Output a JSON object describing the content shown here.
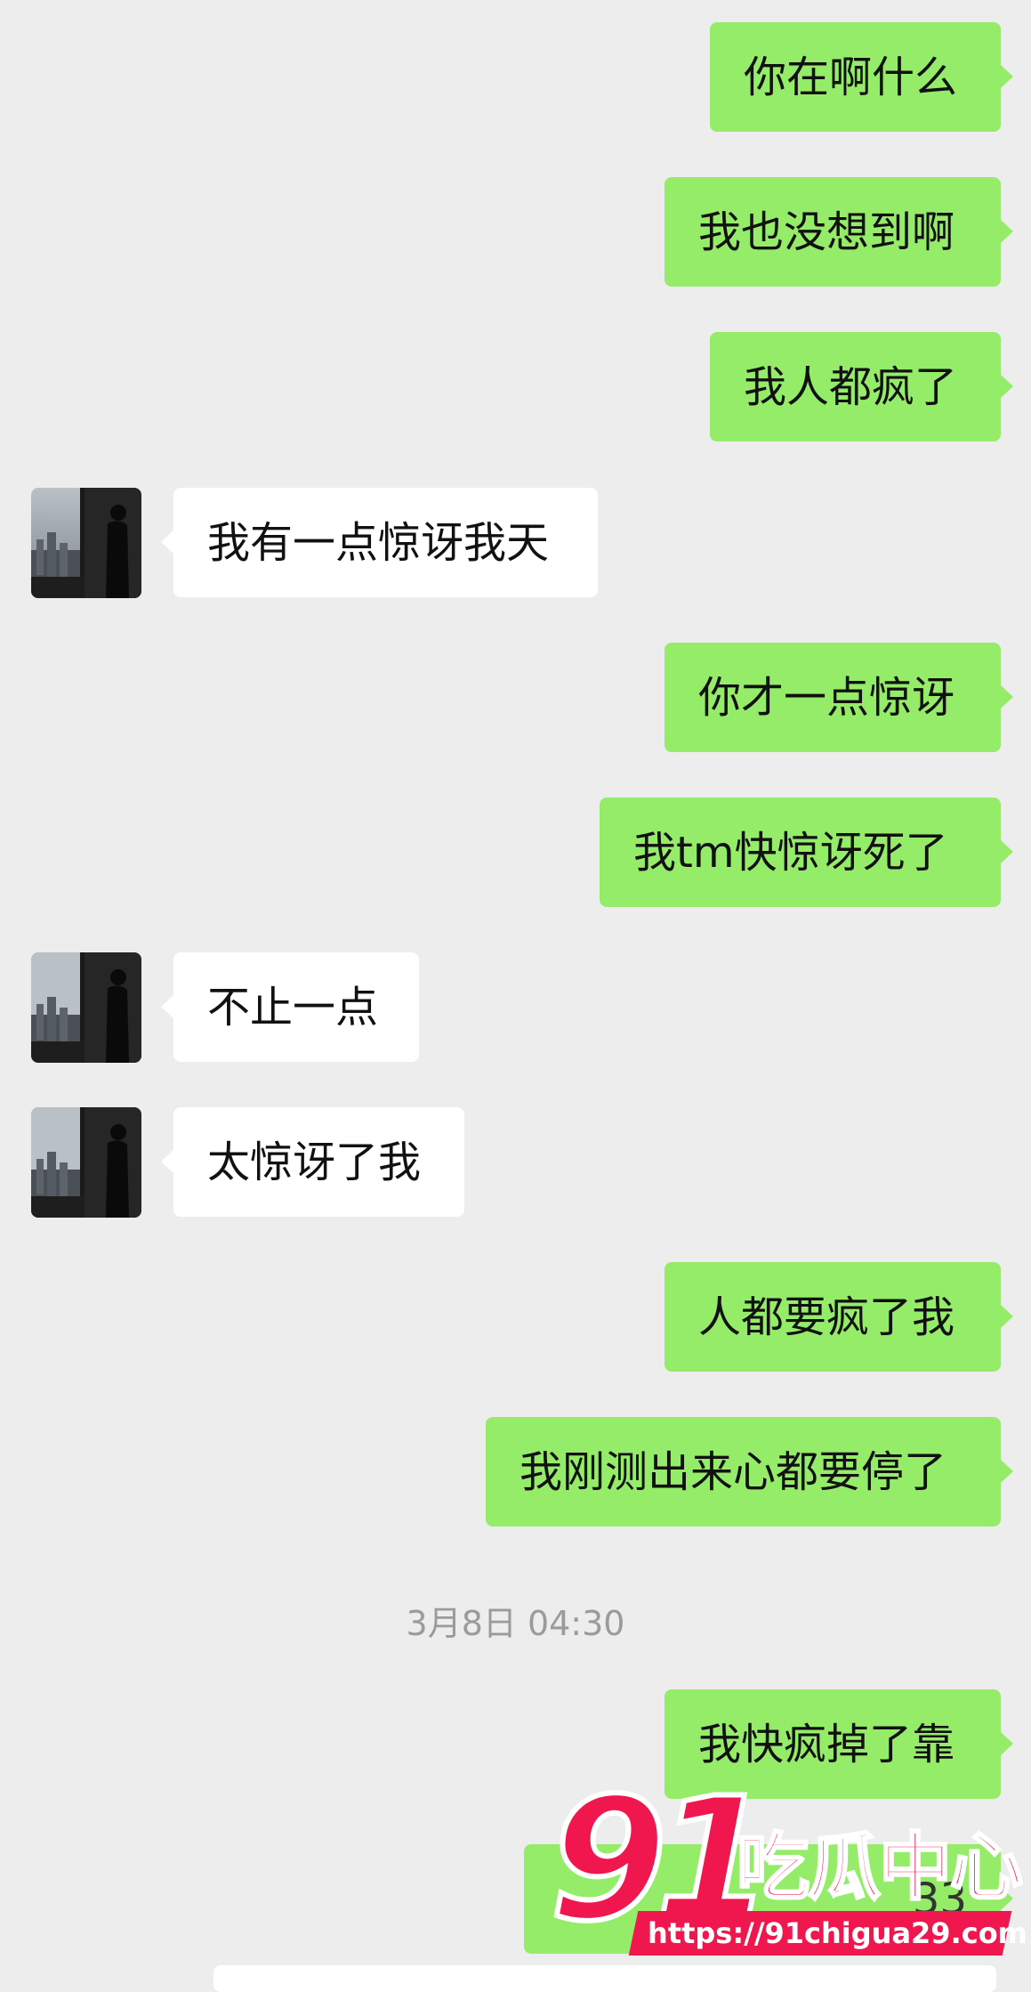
{
  "messages": [
    {
      "side": "out",
      "text": "你在啊什么"
    },
    {
      "side": "out",
      "text": "我也没想到啊"
    },
    {
      "side": "out",
      "text": "我人都疯了"
    },
    {
      "side": "in",
      "text": "我有一点惊讶我天"
    },
    {
      "side": "out",
      "text": "你才一点惊讶"
    },
    {
      "side": "out",
      "text": "我tm快惊讶死了"
    },
    {
      "side": "in",
      "text": "不止一点"
    },
    {
      "side": "in",
      "text": "太惊讶了我"
    },
    {
      "side": "out",
      "text": "人都要疯了我"
    },
    {
      "side": "out",
      "text": "我刚测出来心都要停了"
    },
    {
      "side": "out",
      "text": "我快疯掉了靠"
    },
    {
      "side": "out",
      "text": "33"
    }
  ],
  "timestamp": "3月8日 04:30",
  "watermark": {
    "number": "91",
    "brand": "吃瓜中心",
    "url": "https://91chigua29.com"
  },
  "colors": {
    "outgoing_bubble": "#95ec69",
    "incoming_bubble": "#ffffff",
    "background": "#ededed",
    "watermark": "#f0174e"
  },
  "avatar": {
    "description_icon": "avatar-silhouette-window"
  }
}
